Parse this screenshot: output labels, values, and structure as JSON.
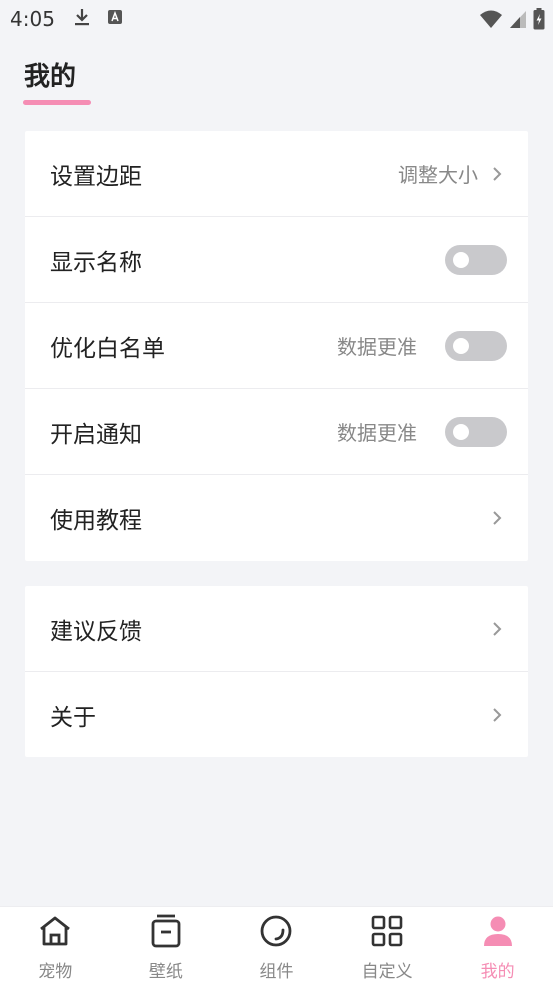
{
  "status_bar": {
    "time": "4:05"
  },
  "page": {
    "title": "我的"
  },
  "settings": {
    "group1": [
      {
        "label": "设置边距",
        "value": "调整大小",
        "control": "chevron"
      },
      {
        "label": "显示名称",
        "value": "",
        "control": "toggle",
        "on": false
      },
      {
        "label": "优化白名单",
        "value": "数据更准",
        "control": "toggle",
        "on": false
      },
      {
        "label": "开启通知",
        "value": "数据更准",
        "control": "toggle",
        "on": false
      },
      {
        "label": "使用教程",
        "value": "",
        "control": "chevron"
      }
    ],
    "group2": [
      {
        "label": "建议反馈",
        "control": "chevron"
      },
      {
        "label": "关于",
        "control": "chevron"
      }
    ]
  },
  "tabs": [
    {
      "label": "宠物",
      "icon": "home-icon",
      "active": false
    },
    {
      "label": "壁纸",
      "icon": "wallpaper-icon",
      "active": false
    },
    {
      "label": "组件",
      "icon": "widget-icon",
      "active": false
    },
    {
      "label": "自定义",
      "icon": "grid-icon",
      "active": false
    },
    {
      "label": "我的",
      "icon": "person-icon",
      "active": true
    }
  ],
  "colors": {
    "accent": "#f58db4",
    "background": "#f3f4f7",
    "toggle_off": "#c9c9cc",
    "text_secondary": "#888888"
  }
}
